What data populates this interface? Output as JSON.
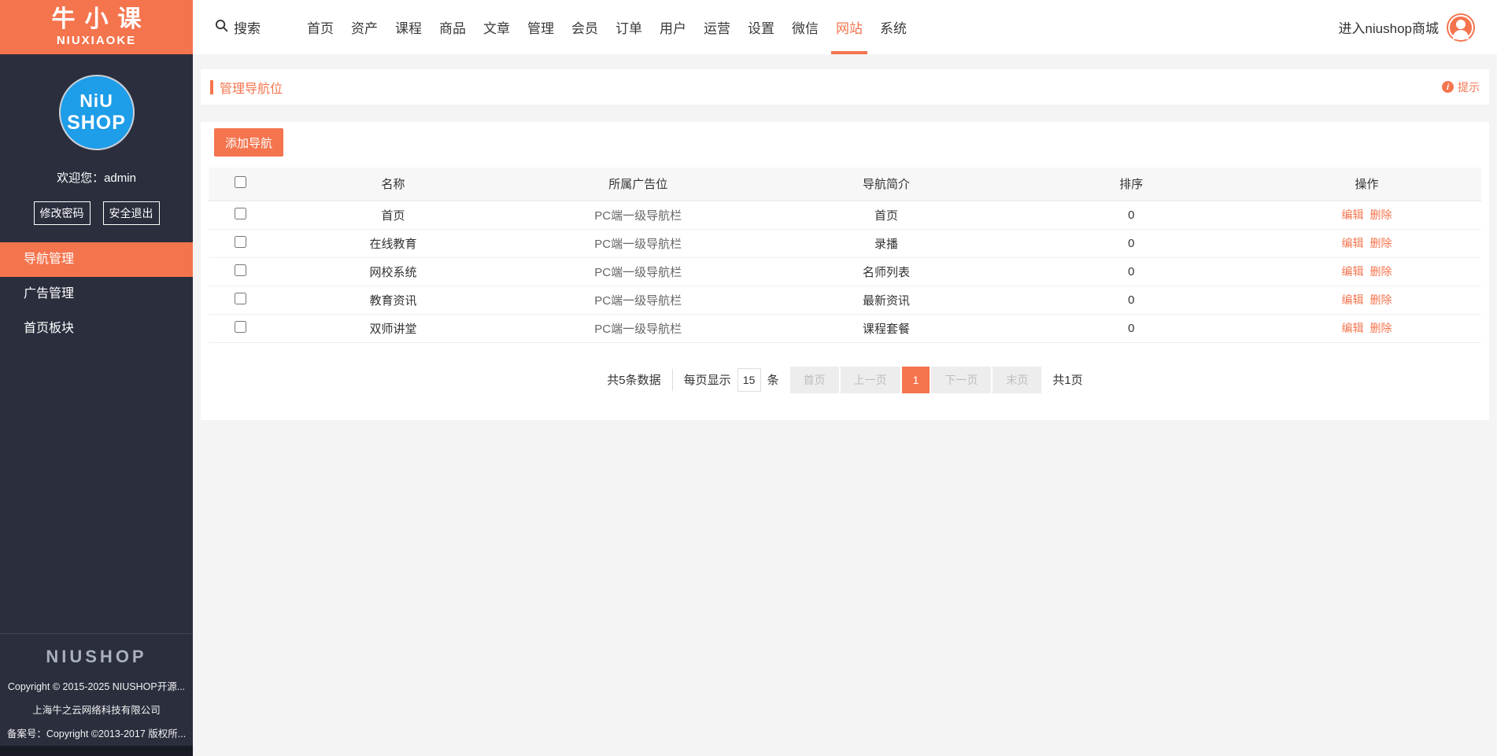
{
  "colors": {
    "accent": "#f4744e",
    "sidebar-bg": "#2a2e3d",
    "logo-blue": "#1e9de8"
  },
  "brand": {
    "title_cn": "牛小课",
    "title_en": "NIUXIAOKE",
    "badge_top": "NiU",
    "badge_bottom": "SHOP"
  },
  "topnav": {
    "search_label": "搜索",
    "items": [
      "首页",
      "资产",
      "课程",
      "商品",
      "文章",
      "管理",
      "会员",
      "订单",
      "用户",
      "运营",
      "设置",
      "微信",
      "网站",
      "系统"
    ],
    "active_item": "网站",
    "enter_shop": "进入niushop商城"
  },
  "sidebar": {
    "welcome": "欢迎您：admin",
    "change_password": "修改密码",
    "logout": "安全退出",
    "menu": [
      "导航管理",
      "广告管理",
      "首页板块"
    ],
    "active_menu": "导航管理",
    "footer": {
      "wordmark": "NIUSHOP",
      "lines": [
        "Copyright © 2015-2025 NIUSHOP开源...",
        "上海牛之云网络科技有限公司",
        "备案号：Copyright ©2013-2017 版权所..."
      ]
    }
  },
  "page": {
    "title": "管理导航位",
    "tip_label": "提示"
  },
  "toolbar": {
    "add_nav": "添加导航"
  },
  "table": {
    "headers": [
      "名称",
      "所属广告位",
      "导航简介",
      "排序",
      "操作"
    ],
    "rows": [
      {
        "name": "首页",
        "ad_position": "PC端一级导航栏",
        "intro": "首页",
        "sort": "0",
        "edit": "编辑",
        "delete": "删除"
      },
      {
        "name": "在线教育",
        "ad_position": "PC端一级导航栏",
        "intro": "录播",
        "sort": "0",
        "edit": "编辑",
        "delete": "删除"
      },
      {
        "name": "网校系统",
        "ad_position": "PC端一级导航栏",
        "intro": "名师列表",
        "sort": "0",
        "edit": "编辑",
        "delete": "删除"
      },
      {
        "name": "教育资讯",
        "ad_position": "PC端一级导航栏",
        "intro": "最新资讯",
        "sort": "0",
        "edit": "编辑",
        "delete": "删除"
      },
      {
        "name": "双师讲堂",
        "ad_position": "PC端一级导航栏",
        "intro": "课程套餐",
        "sort": "0",
        "edit": "编辑",
        "delete": "删除"
      }
    ]
  },
  "pagination": {
    "total_text": "共5条数据",
    "per_page_prefix": "每页显示",
    "per_page_value": "15",
    "per_page_unit": "条",
    "first": "首页",
    "prev": "上一页",
    "current": "1",
    "next": "下一页",
    "last": "末页",
    "total_pages": "共1页"
  }
}
